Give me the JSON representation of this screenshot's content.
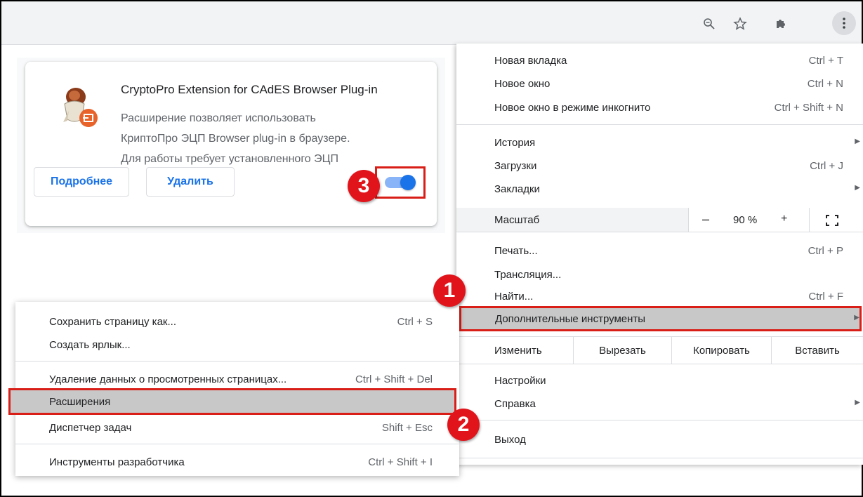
{
  "toolbar": {
    "icons": [
      "zoom-icon",
      "star-icon",
      "puzzle-icon",
      "kebab-menu-icon"
    ]
  },
  "extension": {
    "title": "CryptoPro Extension for CAdES Browser Plug-in",
    "desc_line1": "Расширение позволяет использовать",
    "desc_line2": "КриптоПро ЭЦП Browser plug-in в браузере.",
    "desc_line3": "Для работы требует установленного ЭЦП",
    "details_label": "Подробнее",
    "remove_label": "Удалить",
    "enabled": true
  },
  "badges": {
    "one": "1",
    "two": "2",
    "three": "3"
  },
  "menu": {
    "new_tab": "Новая вкладка",
    "new_tab_sc": "Ctrl + T",
    "new_window": "Новое окно",
    "new_window_sc": "Ctrl + N",
    "incognito": "Новое окно в режиме инкогнито",
    "incognito_sc": "Ctrl + Shift + N",
    "history": "История",
    "downloads": "Загрузки",
    "downloads_sc": "Ctrl + J",
    "bookmarks": "Закладки",
    "zoom_label": "Масштаб",
    "zoom_minus": "–",
    "zoom_value": "90 %",
    "zoom_plus": "+",
    "print": "Печать...",
    "print_sc": "Ctrl + P",
    "cast": "Трансляция...",
    "find": "Найти...",
    "find_sc": "Ctrl + F",
    "more_tools": "Дополнительные инструменты",
    "edit": "Изменить",
    "cut": "Вырезать",
    "copy": "Копировать",
    "paste": "Вставить",
    "settings": "Настройки",
    "help": "Справка",
    "exit": "Выход"
  },
  "submenu": {
    "save_page": "Сохранить страницу как...",
    "save_page_sc": "Ctrl + S",
    "create_shortcut": "Создать ярлык...",
    "clear_data": "Удаление данных о просмотренных страницах...",
    "clear_data_sc": "Ctrl + Shift + Del",
    "extensions": "Расширения",
    "task_manager": "Диспетчер задач",
    "task_manager_sc": "Shift + Esc",
    "dev_tools": "Инструменты разработчика",
    "dev_tools_sc": "Ctrl + Shift + I"
  },
  "colors": {
    "highlight_red": "#d91e18",
    "badge_red": "#e1141b",
    "accent_blue": "#1a73e8",
    "hover_gray": "#c8c8c8"
  }
}
